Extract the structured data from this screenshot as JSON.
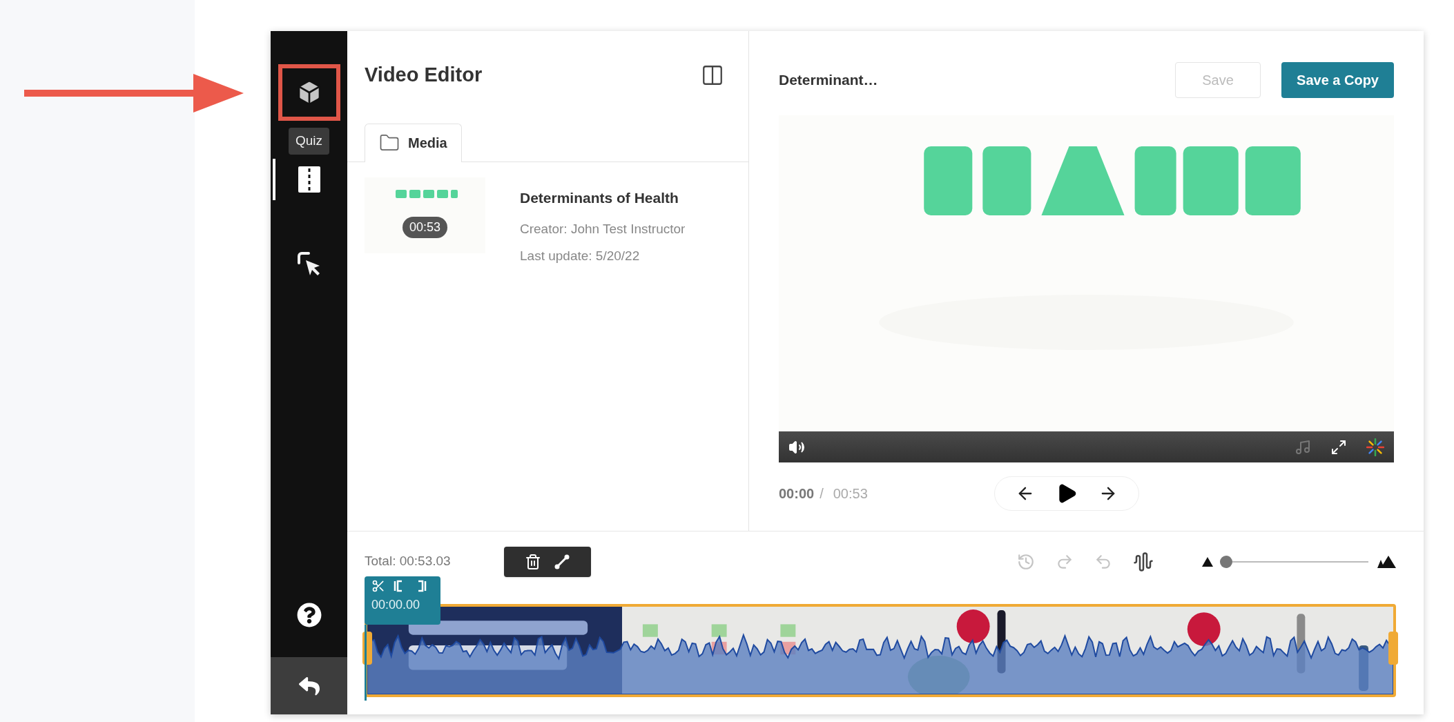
{
  "sidebar": {
    "items": [
      {
        "kind": "quiz",
        "selected": false,
        "tooltip": "Quiz"
      },
      {
        "kind": "clip",
        "selected": true
      },
      {
        "kind": "hotspot",
        "selected": false
      }
    ],
    "bottom": [
      {
        "kind": "help"
      },
      {
        "kind": "back"
      }
    ]
  },
  "media_panel": {
    "title": "Video Editor",
    "tabs": [
      {
        "label": "Media",
        "selected": true
      }
    ],
    "items": [
      {
        "duration": "00:53",
        "title": "Determinants of Health",
        "creator": "Creator: John Test Instructor",
        "updated": "Last update: 5/20/22"
      }
    ]
  },
  "player": {
    "title": "Determinant…",
    "buttons": [
      {
        "label": "Save",
        "disabled": true
      },
      {
        "label": "Save a Copy",
        "disabled": false
      }
    ],
    "current_time": "00:00",
    "separator": "/",
    "duration": "00:53"
  },
  "timeline": {
    "total": "Total: 00:53.03",
    "marker_time": "00:00.00",
    "zoom": {
      "level": 0
    },
    "tools": [
      {
        "kind": "revert",
        "disabled": true
      },
      {
        "kind": "redo",
        "disabled": true
      },
      {
        "kind": "undo",
        "disabled": true
      },
      {
        "kind": "waveform",
        "disabled": false
      }
    ]
  }
}
